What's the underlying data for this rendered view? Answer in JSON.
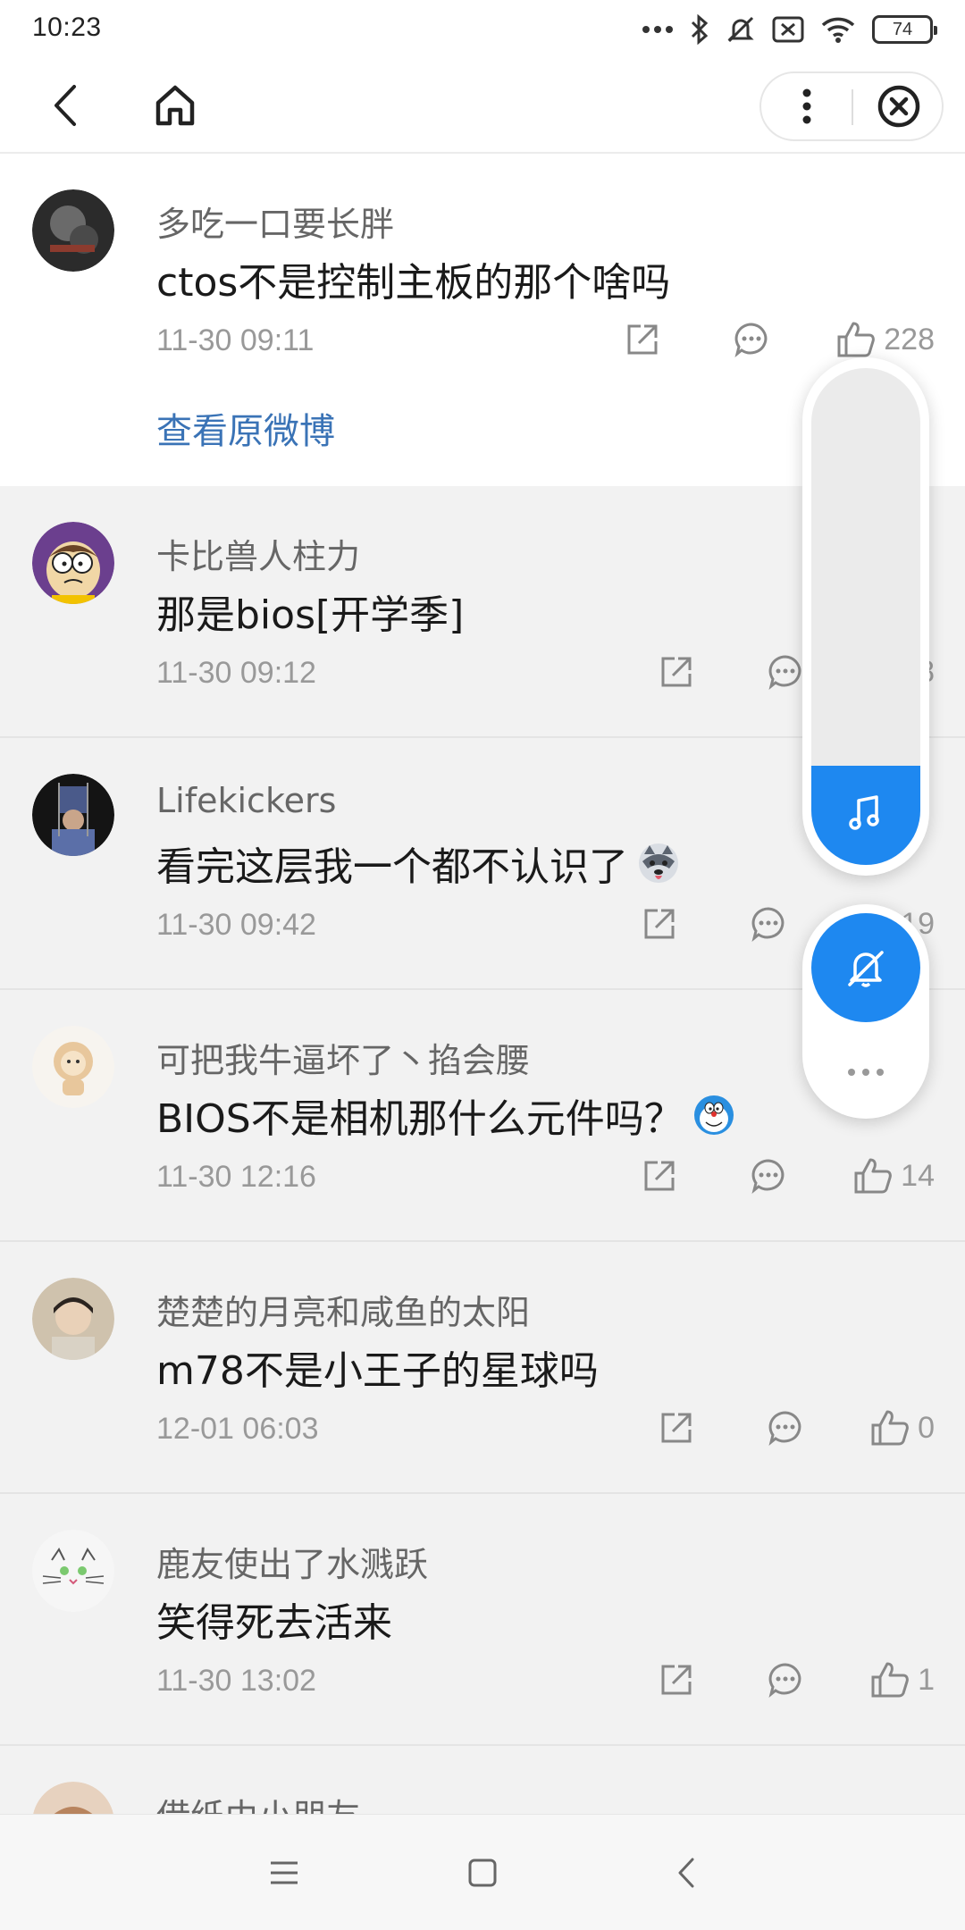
{
  "status_bar": {
    "time": "10:23",
    "battery": "74",
    "icons": [
      "dots-icon",
      "bluetooth-icon",
      "mute-icon",
      "sim-off-icon",
      "wifi-icon",
      "battery-icon"
    ]
  },
  "nav": {
    "icons": [
      "back-icon",
      "home-icon",
      "more-vertical-icon",
      "close-circle-icon"
    ]
  },
  "comments": [
    {
      "user": "多吃一口要长胖",
      "text": "ctos不是控制主板的那个啥吗",
      "time": "11-30 09:11",
      "likes": "228",
      "view_original": "查看原微博"
    },
    {
      "user": "卡比兽人柱力",
      "text": "那是bios[开学季]",
      "time": "11-30 09:12",
      "likes": "8"
    },
    {
      "user": "Lifekickers",
      "text": "看完这层我一个都不认识了",
      "time": "11-30 09:42",
      "likes": "19"
    },
    {
      "user": "可把我牛逼坏了丶掐会腰",
      "text": "BIOS不是相机那什么元件吗？",
      "time": "11-30 12:16",
      "likes": "14"
    },
    {
      "user": "楚楚的月亮和咸鱼的太阳",
      "text": "m78不是小王子的星球吗",
      "time": "12-01 06:03",
      "likes": "0"
    },
    {
      "user": "鹿友使出了水溅跃",
      "text": "笑得死去活来",
      "time": "11-30 13:02",
      "likes": "1"
    },
    {
      "user": "借纸巾小朋友"
    }
  ],
  "floating_widget": {
    "volume_level": 0.2,
    "icons": [
      "music-note-icon",
      "bell-off-icon",
      "more-dots-icon"
    ]
  },
  "system_nav": {
    "icons": [
      "menu-icon",
      "square-icon",
      "back-triangle-icon"
    ]
  },
  "colors": {
    "accent": "#1e88f0",
    "link": "#3a73b6",
    "list_bg": "#f2f2f2",
    "muted_text": "#999999"
  }
}
